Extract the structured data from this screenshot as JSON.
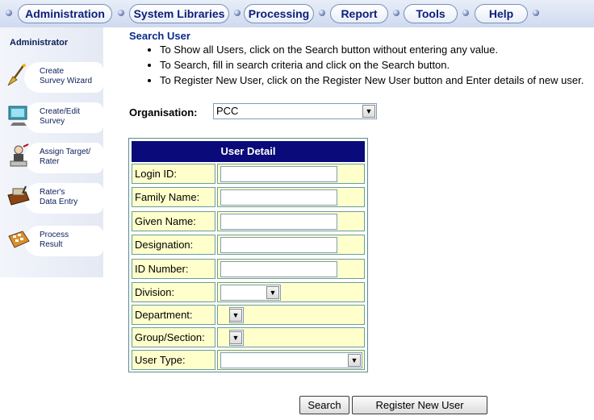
{
  "menu": [
    "Administration",
    "System Libraries",
    "Processing",
    "Report",
    "Tools",
    "Help"
  ],
  "sidebar": {
    "title": "Administrator",
    "items": [
      {
        "line1": "Create",
        "line2": "Survey Wizard",
        "icon": "wizard-icon"
      },
      {
        "line1": "Create/Edit",
        "line2": "Survey",
        "icon": "monitor-icon"
      },
      {
        "line1": "Assign Target/",
        "line2": "Rater",
        "icon": "target-rater-icon"
      },
      {
        "line1": "Rater's",
        "line2": "Data Entry",
        "icon": "data-entry-icon"
      },
      {
        "line1": "Process",
        "line2": "Result",
        "icon": "calculator-icon"
      }
    ]
  },
  "main": {
    "title": "Search User",
    "instructions": [
      "To Show all Users, click on the Search button without entering any value.",
      "To Search, fill in search criteria and click on the Search button.",
      "To Register New User, click on the Register New User button and Enter details of new user."
    ],
    "organisation_label": "Organisation:",
    "organisation_value": "PCC"
  },
  "form": {
    "header": "User Detail",
    "fields": {
      "login_id": "Login ID:",
      "family_name": "Family Name:",
      "given_name": "Given Name:",
      "designation": "Designation:",
      "id_number": "ID Number:",
      "division": "Division:",
      "department": "Department:",
      "group_section": "Group/Section:",
      "user_type": "User Type:"
    }
  },
  "buttons": {
    "search": "Search",
    "register": "Register New User"
  },
  "colors": {
    "header_bg": "#0a0a7a",
    "row_bg": "#ffffcc",
    "title": "#0b2a8a"
  }
}
